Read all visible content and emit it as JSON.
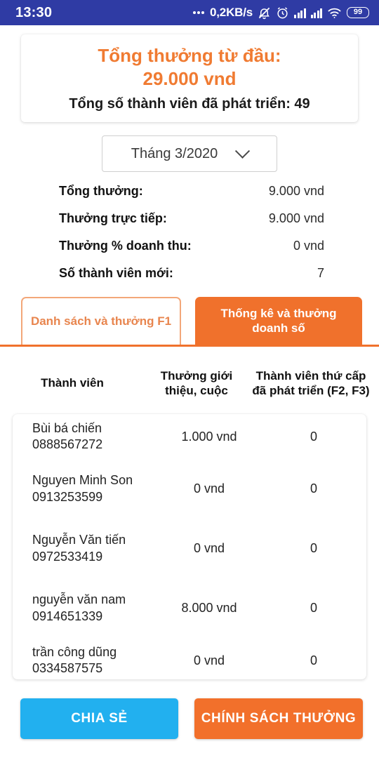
{
  "status_bar": {
    "time": "13:30",
    "network_speed": "0,2KB/s",
    "battery": "99",
    "icons": [
      "bell-muted-icon",
      "alarm-clock-icon",
      "signal-bars-icon",
      "signal-bars-icon",
      "wifi-icon",
      "battery-icon"
    ],
    "background_color": "#2f3ba4"
  },
  "summary": {
    "title": "Tổng thưởng từ đầu:",
    "amount": "29.000 vnd",
    "members_line": "Tổng số thành viên đã phát triển: 49",
    "accent_color": "#f07b32"
  },
  "month_select": {
    "value": "Tháng 3/2020",
    "chevron": "chevron-down-icon"
  },
  "stats": [
    {
      "label": "Tổng thưởng:",
      "value": "9.000 vnd"
    },
    {
      "label": "Thưởng trực tiếp:",
      "value": "9.000 vnd"
    },
    {
      "label": "Thưởng % doanh thu:",
      "value": "0 vnd"
    },
    {
      "label": "Số thành viên mới:",
      "value": "7"
    }
  ],
  "tabs": [
    {
      "label": "Danh sách và thưởng F1",
      "active": false
    },
    {
      "label": "Thống kê và thưởng doanh số",
      "active": true
    }
  ],
  "table": {
    "headers": {
      "col1": "Thành viên",
      "col2": "Thưởng giới thiệu, cuộc",
      "col3": "Thành viên thứ cấp đã phát triển (F2, F3)"
    },
    "rows": [
      {
        "name": "Bùi bá chiến",
        "phone": "0888567272",
        "bonus": "1.000 vnd",
        "sub_members": "0"
      },
      {
        "name": "Nguyen Minh Son",
        "phone": "0913253599",
        "bonus": "0 vnd",
        "sub_members": "0"
      },
      {
        "name": "Nguyễn Văn tiến",
        "phone": "0972533419",
        "bonus": "0 vnd",
        "sub_members": "0"
      },
      {
        "name": "nguyễn văn nam",
        "phone": "0914651339",
        "bonus": "8.000 vnd",
        "sub_members": "0"
      },
      {
        "name": "trần công dũng",
        "phone": "0334587575",
        "bonus": "0 vnd",
        "sub_members": "0"
      }
    ]
  },
  "buttons": {
    "share": "CHIA SẺ",
    "share_color": "#22b0ef",
    "policy": "CHÍNH SÁCH THƯỞNG",
    "policy_color": "#f2702b"
  }
}
